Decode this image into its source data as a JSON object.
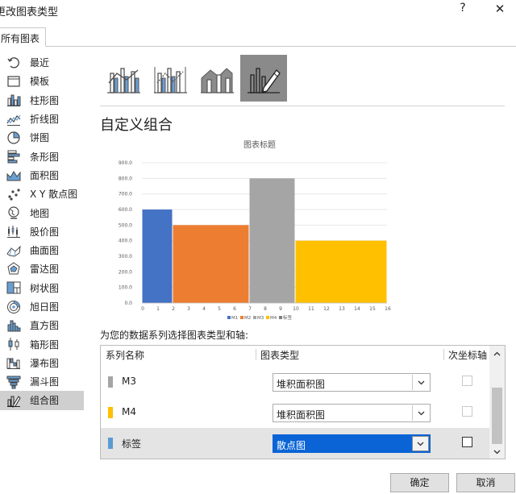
{
  "dialog": {
    "title": "更改图表类型",
    "help": "?",
    "close": "✕"
  },
  "tab": {
    "label": "所有图表"
  },
  "sidebar": {
    "items": [
      {
        "label": "最近",
        "icon": "recent-icon"
      },
      {
        "label": "模板",
        "icon": "template-icon"
      },
      {
        "label": "柱形图",
        "icon": "column-chart-icon"
      },
      {
        "label": "折线图",
        "icon": "line-chart-icon"
      },
      {
        "label": "饼图",
        "icon": "pie-chart-icon"
      },
      {
        "label": "条形图",
        "icon": "bar-chart-icon"
      },
      {
        "label": "面积图",
        "icon": "area-chart-icon"
      },
      {
        "label": "X Y 散点图",
        "icon": "scatter-chart-icon"
      },
      {
        "label": "地图",
        "icon": "map-chart-icon"
      },
      {
        "label": "股价图",
        "icon": "stock-chart-icon"
      },
      {
        "label": "曲面图",
        "icon": "surface-chart-icon"
      },
      {
        "label": "雷达图",
        "icon": "radar-chart-icon"
      },
      {
        "label": "树状图",
        "icon": "treemap-chart-icon"
      },
      {
        "label": "旭日图",
        "icon": "sunburst-chart-icon"
      },
      {
        "label": "直方图",
        "icon": "histogram-chart-icon"
      },
      {
        "label": "箱形图",
        "icon": "box-whisker-chart-icon"
      },
      {
        "label": "瀑布图",
        "icon": "waterfall-chart-icon"
      },
      {
        "label": "漏斗图",
        "icon": "funnel-chart-icon"
      },
      {
        "label": "组合图",
        "icon": "combo-chart-icon"
      }
    ],
    "selected_index": 18
  },
  "combo_types": [
    {
      "name": "clustered-column-line",
      "selected": false
    },
    {
      "name": "clustered-column-line-secondary-axis",
      "selected": false
    },
    {
      "name": "stacked-area-clustered-column",
      "selected": false
    },
    {
      "name": "custom-combination",
      "selected": true
    }
  ],
  "section": {
    "title": "自定义组合"
  },
  "chart_data": {
    "type": "bar",
    "title": "图表标题",
    "xlabel": "",
    "ylabel": "",
    "ylim": [
      0,
      900
    ],
    "xlim": [
      0,
      16
    ],
    "y_ticks": [
      "0.0",
      "100.0",
      "200.0",
      "300.0",
      "400.0",
      "500.0",
      "600.0",
      "700.0",
      "800.0",
      "900.0"
    ],
    "x_ticks": [
      "0",
      "1",
      "2",
      "3",
      "4",
      "5",
      "6",
      "7",
      "8",
      "9",
      "10",
      "11",
      "12",
      "13",
      "14",
      "15",
      "16"
    ],
    "series": [
      {
        "name": "M1",
        "x_start": 0,
        "x_end": 2,
        "value": 600,
        "color": "#4472c4"
      },
      {
        "name": "M2",
        "x_start": 2,
        "x_end": 7,
        "value": 500,
        "color": "#ed7d31"
      },
      {
        "name": "M3",
        "x_start": 7,
        "x_end": 10,
        "value": 800,
        "color": "#a5a5a5"
      },
      {
        "name": "M4",
        "x_start": 10,
        "x_end": 16,
        "value": 400,
        "color": "#ffc000"
      }
    ],
    "legend": [
      "M1",
      "M2",
      "M3",
      "M4",
      "标签"
    ],
    "legend_position": "bottom",
    "grid": true
  },
  "series_prompt": "为您的数据系列选择图表类型和轴:",
  "series_table": {
    "headers": {
      "name": "系列名称",
      "type": "图表类型",
      "secondary": "次坐标轴"
    },
    "rows": [
      {
        "name": "M3",
        "color": "#a5a5a5",
        "type": "堆积面积图",
        "secondary": false,
        "secondary_enabled": false,
        "active": false
      },
      {
        "name": "M4",
        "color": "#ffc000",
        "type": "堆积面积图",
        "secondary": false,
        "secondary_enabled": false,
        "active": false
      },
      {
        "name": "标签",
        "color": "#5b9bd5",
        "type": "散点图",
        "secondary": false,
        "secondary_enabled": true,
        "active": true
      }
    ]
  },
  "buttons": {
    "ok": "确定",
    "cancel": "取消"
  }
}
